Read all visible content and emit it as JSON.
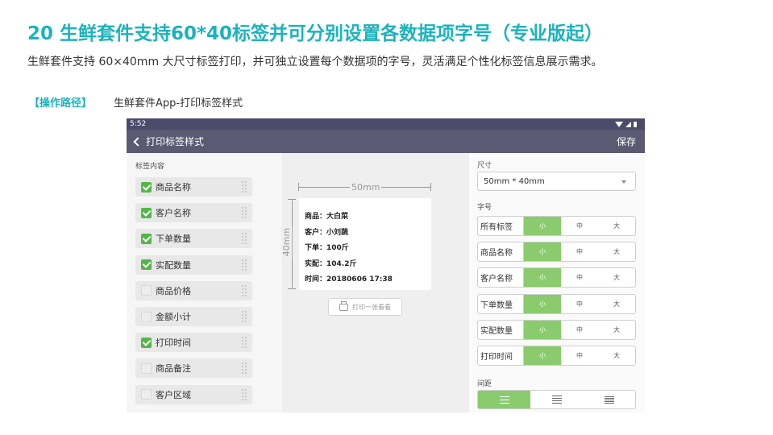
{
  "slide": {
    "title": "20  生鲜套件支持60*40标签并可分别设置各数据项字号（专业版起）",
    "description": "生鲜套件支持 60×40mm 大尺寸标签打印，并可独立设置每个数据项的字号，灵活满足个性化标签信息展示需求。",
    "path_tag": "【操作路径】",
    "path_text": "生鲜套件App-打印标签样式"
  },
  "device": {
    "status_time": "5:52",
    "nav_title": "打印标签样式",
    "save_label": "保存"
  },
  "left_panel": {
    "section_title": "标签内容",
    "items": [
      {
        "label": "商品名称",
        "checked": true
      },
      {
        "label": "客户名称",
        "checked": true
      },
      {
        "label": "下单数量",
        "checked": true
      },
      {
        "label": "实配数量",
        "checked": true
      },
      {
        "label": "商品价格",
        "checked": false
      },
      {
        "label": "金额小计",
        "checked": false
      },
      {
        "label": "打印时间",
        "checked": true
      },
      {
        "label": "商品备注",
        "checked": false
      },
      {
        "label": "客户区域",
        "checked": false
      }
    ]
  },
  "preview": {
    "width_label": "50mm",
    "height_label": "40mm",
    "lines": [
      "商品：大白菜",
      "客户：小刘蔬",
      "下单：100斤",
      "实配：104.2斤",
      "时间：20180606 17:38"
    ],
    "print_button": "打印一张看看"
  },
  "right_panel": {
    "size_title": "尺寸",
    "size_value": "50mm * 40mm",
    "font_title": "字号",
    "font_rows": [
      {
        "label": "所有标签",
        "options": [
          "小",
          "中",
          "大"
        ],
        "selected": "小"
      },
      {
        "label": "商品名称",
        "options": [
          "小",
          "中",
          "大"
        ],
        "selected": "小"
      },
      {
        "label": "客户名称",
        "options": [
          "小",
          "中",
          "大"
        ],
        "selected": "小"
      },
      {
        "label": "下单数量",
        "options": [
          "小",
          "中",
          "大"
        ],
        "selected": "小"
      },
      {
        "label": "实配数量",
        "options": [
          "小",
          "中",
          "大"
        ],
        "selected": "小"
      },
      {
        "label": "打印时间",
        "options": [
          "小",
          "中",
          "大"
        ],
        "selected": "小"
      }
    ],
    "spacing_title": "间距",
    "spacing_options": [
      "narrow-spacing-icon",
      "medium-spacing-icon",
      "wide-spacing-icon"
    ],
    "spacing_selected": 0
  },
  "colors": {
    "title": "#1cb3bd",
    "accent_green": "#8acb6e",
    "check_green": "#56b54a",
    "navbar": "#5a5a72"
  }
}
